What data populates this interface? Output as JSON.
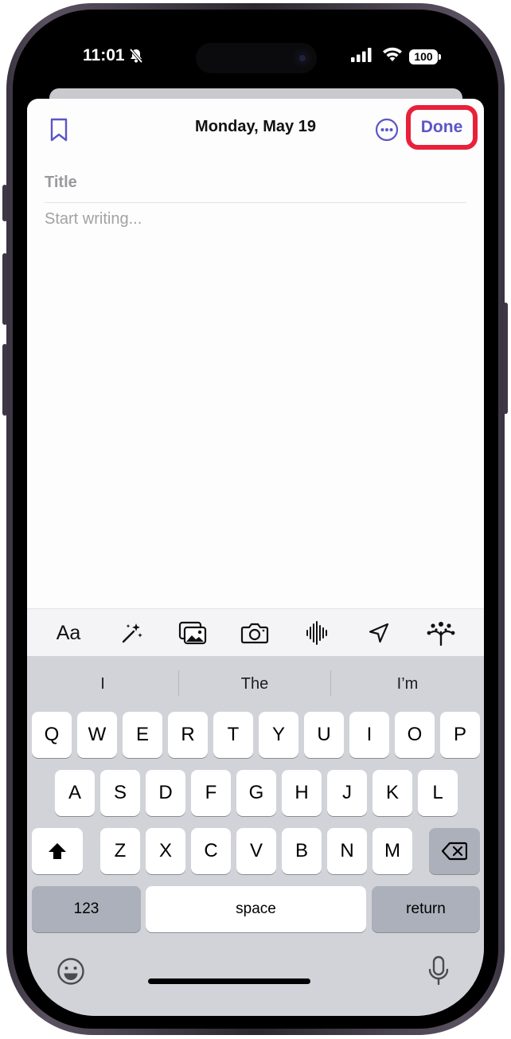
{
  "status_bar": {
    "time": "11:01",
    "battery": "100"
  },
  "header": {
    "date": "Monday, May 19",
    "done_label": "Done",
    "highlight_color": "#e8213a",
    "accent_color": "#5b55c8"
  },
  "editor": {
    "title_placeholder": "Title",
    "body_placeholder": "Start writing..."
  },
  "toolbar": {
    "format_label": "Aa",
    "icons": [
      "magic-wand-icon",
      "photo-library-icon",
      "camera-icon",
      "audio-waveform-icon",
      "location-arrow-icon",
      "suggestions-icon"
    ]
  },
  "keyboard": {
    "suggestions": [
      "I",
      "The",
      "I’m"
    ],
    "row1": [
      "Q",
      "W",
      "E",
      "R",
      "T",
      "Y",
      "U",
      "I",
      "O",
      "P"
    ],
    "row2": [
      "A",
      "S",
      "D",
      "F",
      "G",
      "H",
      "J",
      "K",
      "L"
    ],
    "row3": [
      "Z",
      "X",
      "C",
      "V",
      "B",
      "N",
      "M"
    ],
    "numbers_label": "123",
    "space_label": "space",
    "return_label": "return"
  }
}
